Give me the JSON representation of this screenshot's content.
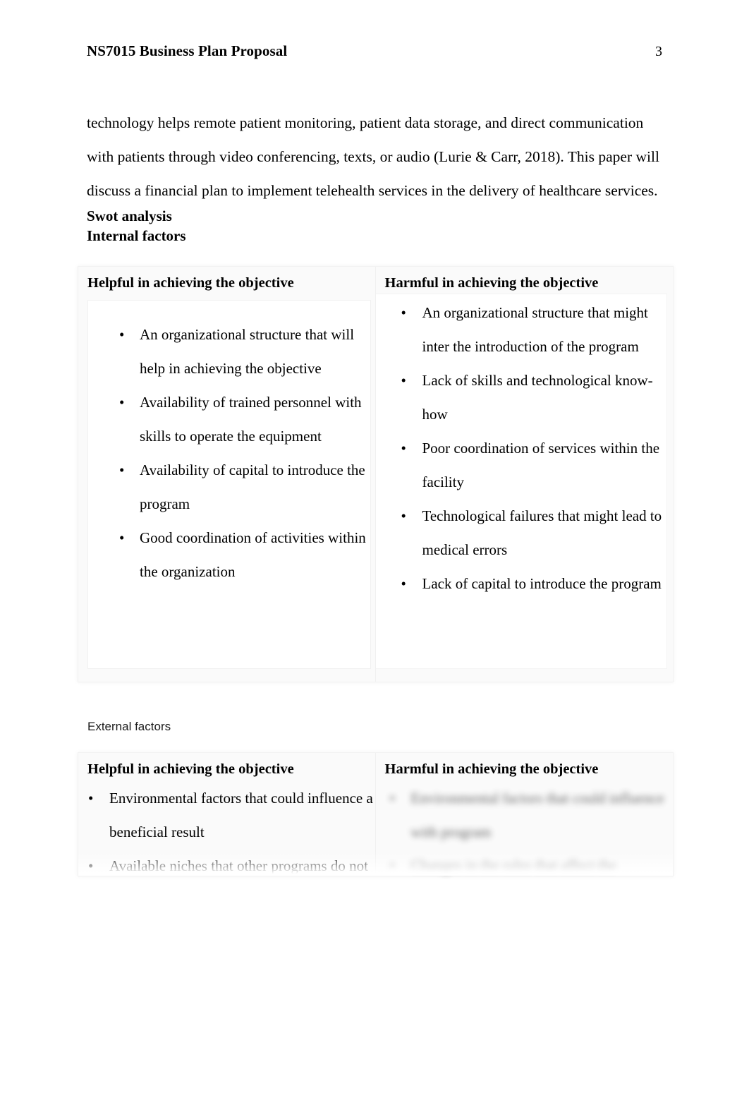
{
  "header": {
    "title": "NS7015 Business Plan Proposal",
    "page_number": "3"
  },
  "body": {
    "paragraph": "technology helps remote patient monitoring, patient data storage, and direct communication with patients through video conferencing, texts, or audio (Lurie & Carr, 2018). This paper will discuss a financial plan to implement telehealth services in the delivery of healthcare services."
  },
  "headings": {
    "swot_analysis": "Swot analysis",
    "internal_factors": "Internal factors",
    "external_factors": "External factors"
  },
  "internal_table": {
    "helpful": {
      "title": "Helpful in achieving the objective",
      "items": [
        "An organizational structure that will help in achieving the objective",
        "Availability of trained personnel with skills to operate the equipment",
        "Availability of capital to introduce the program",
        "Good coordination of activities within the organization"
      ]
    },
    "harmful": {
      "title": "Harmful in achieving the objective",
      "items": [
        "An organizational structure that might inter the introduction of the program",
        "Lack of skills and technological know-how",
        "Poor coordination of services within the facility",
        "Technological failures that might lead to medical errors",
        "Lack of capital to introduce the program"
      ]
    }
  },
  "external_table": {
    "helpful": {
      "title": "Helpful in achieving the objective",
      "items": [
        "Environmental factors that could influence a beneficial result",
        "Available niches that other programs do not"
      ]
    },
    "harmful": {
      "title": "Harmful in achieving the objective",
      "items": [
        "Environmental factors that could influence with program",
        "Changes in the rules that affect the"
      ]
    }
  }
}
